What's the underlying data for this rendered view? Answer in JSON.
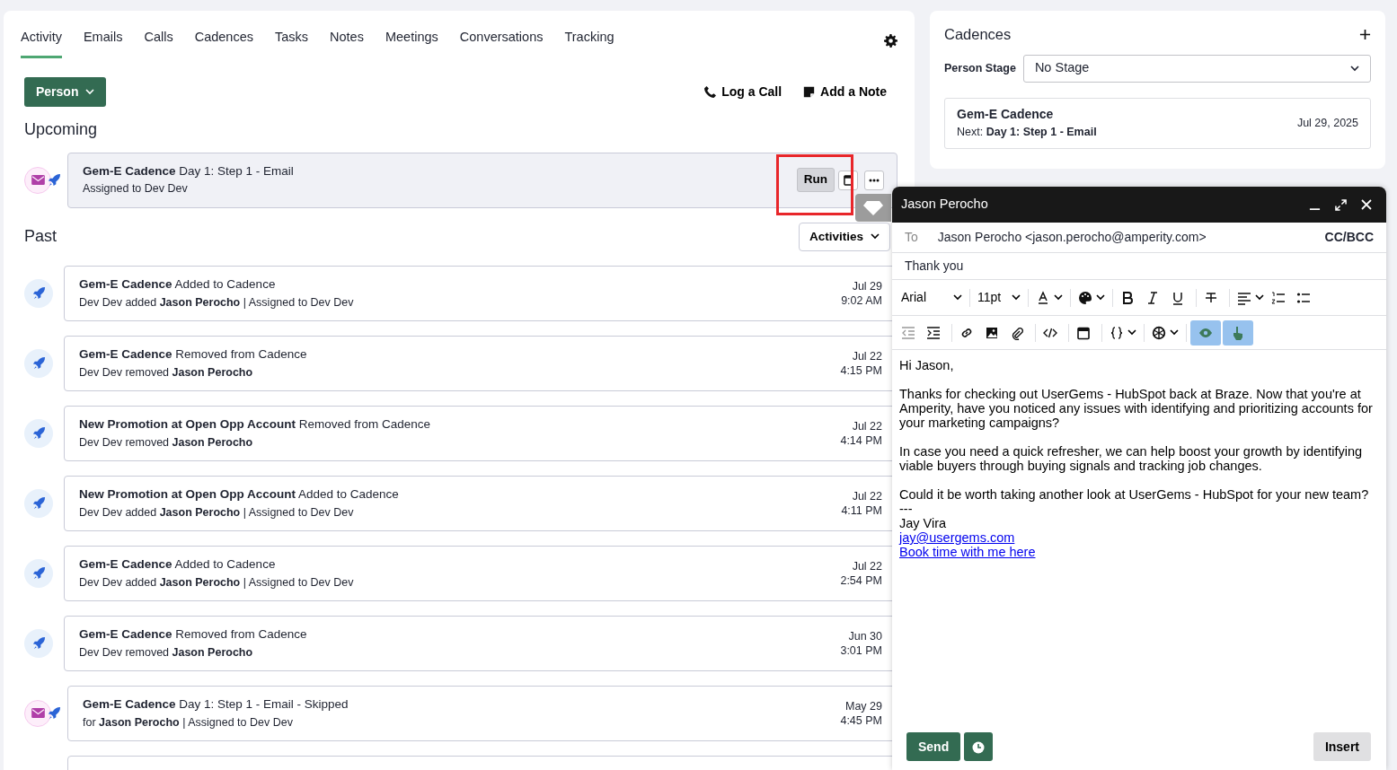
{
  "tabs": [
    {
      "label": "Activity",
      "selected": true
    },
    {
      "label": "Emails",
      "selected": false
    },
    {
      "label": "Calls",
      "selected": false
    },
    {
      "label": "Cadences",
      "selected": false
    },
    {
      "label": "Tasks",
      "selected": false
    },
    {
      "label": "Notes",
      "selected": false
    },
    {
      "label": "Meetings",
      "selected": false
    },
    {
      "label": "Conversations",
      "selected": false
    },
    {
      "label": "Tracking",
      "selected": false
    }
  ],
  "person_button": "Person",
  "actions": [
    {
      "kind": "call",
      "label": "Log a Call"
    },
    {
      "kind": "note",
      "label": "Add a Note"
    }
  ],
  "upcoming": {
    "heading": "Upcoming",
    "items": [
      {
        "kind": "email-cadence",
        "title": "**Gem-E Cadence** Day 1: Step 1 - Email",
        "subtitle": "Assigned to Dev Dev",
        "run": "Run",
        "highlighted": true
      }
    ]
  },
  "past": {
    "heading": "Past",
    "filter": "Activities",
    "items": [
      {
        "kind": "cadence",
        "title": "**Gem-E Cadence** Added to Cadence",
        "subtitle": "Dev Dev added **Jason Perocho** | Assigned to Dev Dev",
        "date": "Jul 29",
        "time": "9:02 AM"
      },
      {
        "kind": "cadence",
        "title": "**Gem-E Cadence** Removed from Cadence",
        "subtitle": "Dev Dev removed **Jason Perocho**",
        "date": "Jul 22",
        "time": "4:15 PM"
      },
      {
        "kind": "cadence",
        "title": "**New Promotion at Open Opp Account** Removed from Cadence",
        "subtitle": "Dev Dev removed **Jason Perocho**",
        "date": "Jul 22",
        "time": "4:14 PM"
      },
      {
        "kind": "cadence",
        "title": "**New Promotion at Open Opp Account** Added to Cadence",
        "subtitle": "Dev Dev added **Jason Perocho** | Assigned to Dev Dev",
        "date": "Jul 22",
        "time": "4:11 PM"
      },
      {
        "kind": "cadence",
        "title": "**Gem-E Cadence** Added to Cadence",
        "subtitle": "Dev Dev added **Jason Perocho** | Assigned to Dev Dev",
        "date": "Jul 22",
        "time": "2:54 PM"
      },
      {
        "kind": "cadence",
        "title": "**Gem-E Cadence** Removed from Cadence",
        "subtitle": "Dev Dev removed **Jason Perocho**",
        "date": "Jun 30",
        "time": "3:01 PM"
      },
      {
        "kind": "email-cadence",
        "title": "**Gem-E Cadence** Day 1: Step 1 - Email - Skipped",
        "subtitle": "for **Jason Perocho** | Assigned to Dev Dev",
        "date": "May 29",
        "time": "4:45 PM"
      }
    ]
  },
  "cadences_panel": {
    "title": "Cadences",
    "stage_label": "Person Stage",
    "stage_value": "No Stage",
    "items": [
      {
        "name": "Gem-E Cadence",
        "next": "Next: **Day 1: Step 1 - Email**",
        "date": "Jul 29, 2025"
      }
    ]
  },
  "compose": {
    "title": "Jason Perocho",
    "to_label": "To",
    "to": "Jason Perocho <jason.perocho@amperity.com>",
    "cc_bcc": "CC/BCC",
    "subject": "Thank you",
    "font": "Arial",
    "size": "11pt",
    "preview_on": true,
    "tracking_on": true,
    "body": [
      {
        "kind": "text",
        "text": "Hi Jason,"
      },
      {
        "kind": "gap"
      },
      {
        "kind": "text",
        "text": "Thanks for checking out UserGems - HubSpot back at Braze. Now that you're at Amperity, have you noticed any issues with identifying and prioritizing accounts for your marketing campaigns?"
      },
      {
        "kind": "gap"
      },
      {
        "kind": "text",
        "text": "In case you need a quick refresher, we can help boost your growth by identifying viable buyers through buying signals and tracking job changes."
      },
      {
        "kind": "gap"
      },
      {
        "kind": "text",
        "text": "Could it be worth taking another look at UserGems - HubSpot for your new team?"
      },
      {
        "kind": "text",
        "text": "---"
      },
      {
        "kind": "text",
        "text": "Jay Vira"
      },
      {
        "kind": "link",
        "text": "jay@usergems.com"
      },
      {
        "kind": "link",
        "text": "Book time with me here"
      }
    ],
    "send": "Send",
    "insert": "Insert"
  }
}
